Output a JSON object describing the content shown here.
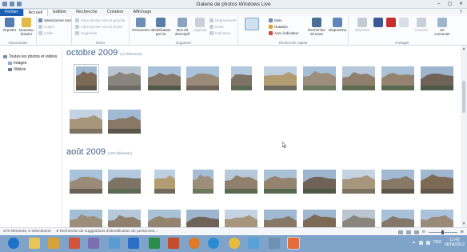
{
  "window": {
    "title": "Galerie de photos Windows Live",
    "controls": [
      "–",
      "▢",
      "✕"
    ]
  },
  "tabs": [
    {
      "label": "Fichier"
    },
    {
      "label": "Accueil"
    },
    {
      "label": "Edition"
    },
    {
      "label": "Recherche"
    },
    {
      "label": "Création"
    },
    {
      "label": "Affichage"
    }
  ],
  "help_label": "?",
  "ribbon": {
    "nouveautes": {
      "label": "Nouveautés",
      "importer": "Importer",
      "nouveau_dossier": "Nouveau dossier"
    },
    "selection": {
      "select_all": "Sélectionner tout",
      "copy": "Copier",
      "paste": "Coller"
    },
    "gerer": {
      "label": "Gérer",
      "rotate_left": "Faire pivoter vers la gauche",
      "rotate_right": "Faire pivoter vers la droite",
      "delete": "Supprimer"
    },
    "organiser": {
      "label": "Organiser",
      "personnes": "Personnes",
      "identification": "Identification par lot",
      "mot_cle": "Mot-clé descriptif",
      "legende": "Légende",
      "deplacement": "Déplacement",
      "noter": "Noter",
      "indicateur": "Indicateur"
    },
    "recherche_rapide": {
      "label": "Recherche rapide",
      "mois": "Mois",
      "notation": "Notation",
      "avec_indicateur": "Avec indicateur",
      "recherche_texte": "Recherche de texte",
      "diaporama": "Diaporama"
    },
    "partager": {
      "label": "Partager",
      "skydrive": "SkyDrive",
      "courrier": "Courrier",
      "se_connecter": "Se connecter"
    }
  },
  "sidebar": {
    "items": [
      {
        "label": "Toutes les photos et vidéos"
      },
      {
        "label": "Images"
      },
      {
        "label": "Vidéos"
      }
    ]
  },
  "sections": [
    {
      "title": "octobre 2009",
      "count": "(12 éléments)"
    },
    {
      "title": "août 2009",
      "count": "(102 éléments)"
    }
  ],
  "statusbar": {
    "selection": "276 éléments, 0 sélectionné",
    "search": "Recherche de suggestions d'identification de personnes..."
  },
  "taskbar": {
    "language": "FRA",
    "time": "13:42",
    "date": "08/06/2012"
  },
  "colors": {
    "file_tab": "#1a5fb4",
    "section_header": "#3e5f8a",
    "taskbar": "#7fa3c9"
  }
}
